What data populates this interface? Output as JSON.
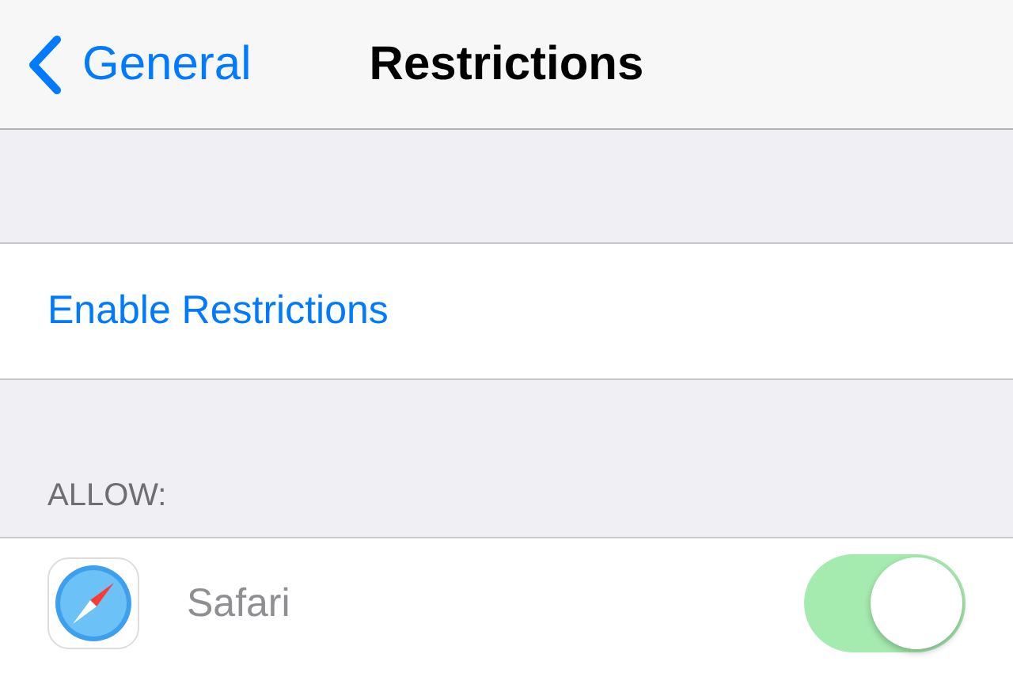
{
  "nav_bar": {
    "back_label": "General",
    "title": "Restrictions"
  },
  "enable_row": {
    "label": "Enable Restrictions"
  },
  "section_header": "ALLOW:",
  "rows": [
    {
      "label": "Safari",
      "on": true,
      "disabled": true
    }
  ]
}
